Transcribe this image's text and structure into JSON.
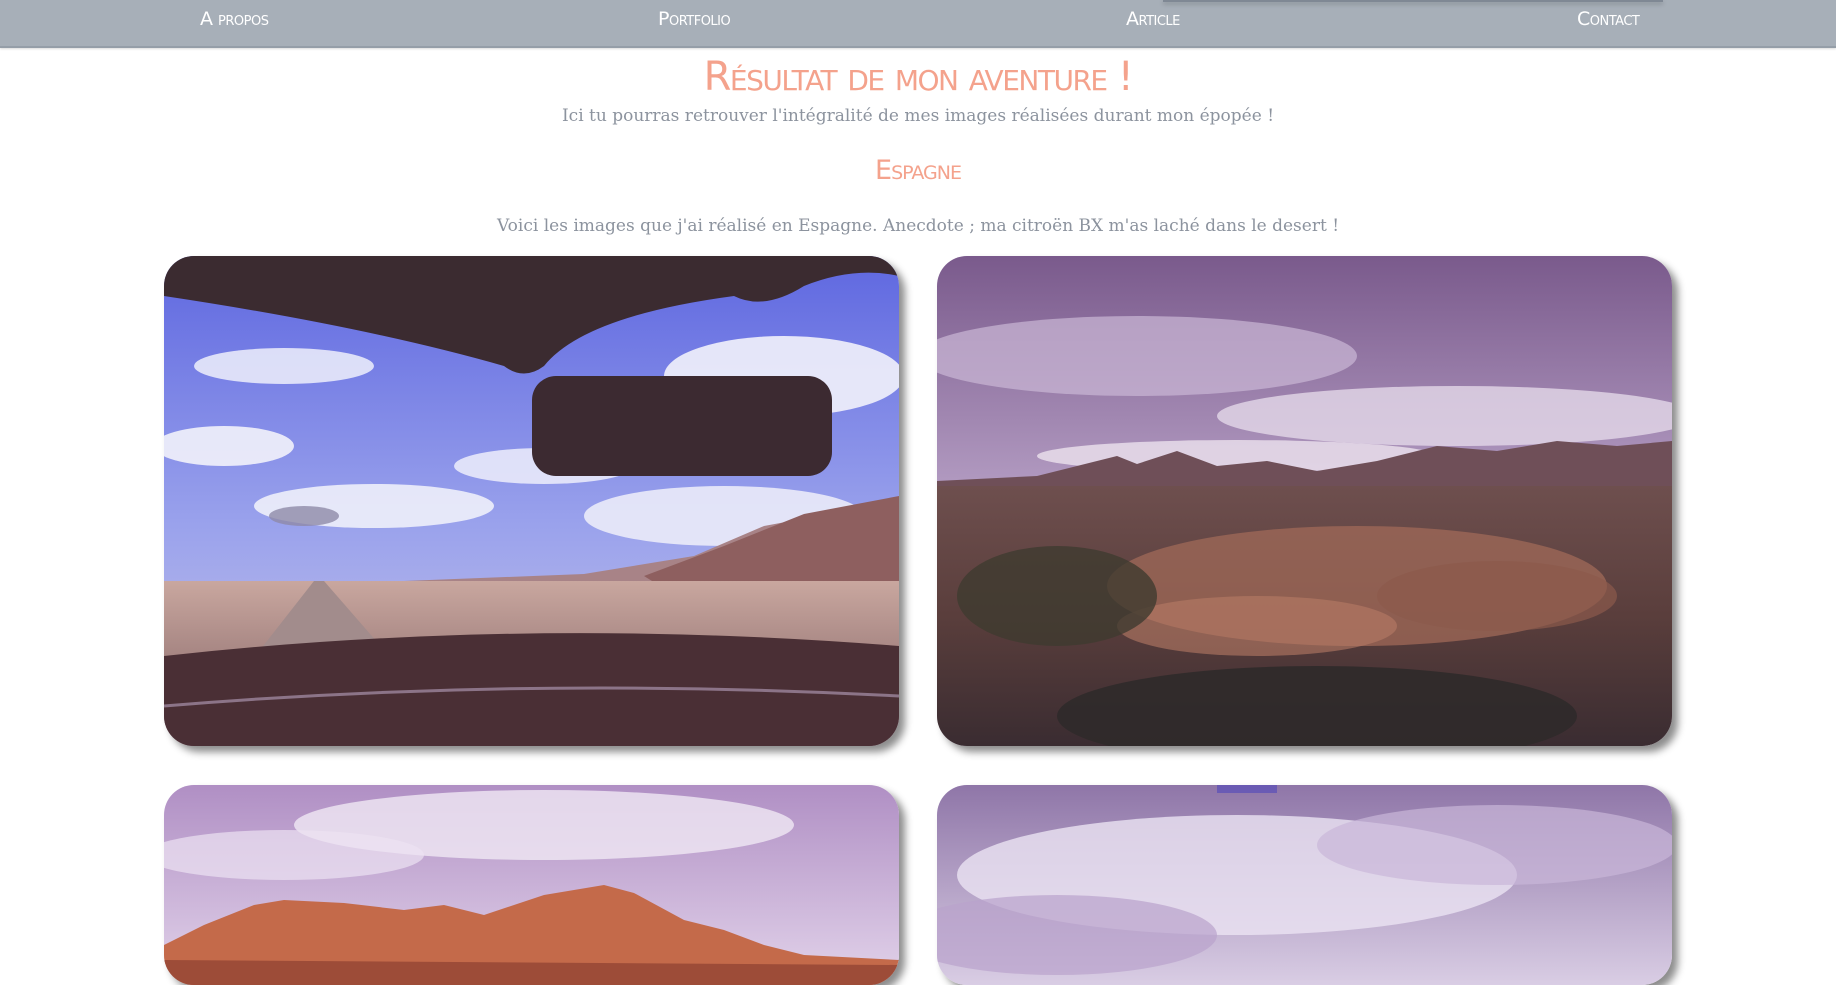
{
  "nav": {
    "items": [
      {
        "label": "A propos"
      },
      {
        "label": "Portfolio"
      },
      {
        "label": "Article"
      },
      {
        "label": "Contact"
      }
    ],
    "active_index": 2
  },
  "header": {
    "title": "Résultat de mon aventure !",
    "subtitle": "Ici tu pourras retrouver l'intégralité de mes images réalisées durant mon épopée !"
  },
  "section": {
    "title": "Espagne",
    "text": "Voici les images que j'ai réalisé en Espagne. Anecdote ; ma citroën BX m'as laché dans le desert !"
  },
  "gallery": {
    "photos": [
      {
        "subject": "car-windshield-desert-road"
      },
      {
        "subject": "desert-landscape-cloudy-sky"
      },
      {
        "subject": "red-mesa-cliffs"
      },
      {
        "subject": "stormy-sky"
      }
    ]
  },
  "colors": {
    "nav_background": "#a7afb8",
    "title_accent": "#f4a28c",
    "body_text": "#8c939e"
  }
}
